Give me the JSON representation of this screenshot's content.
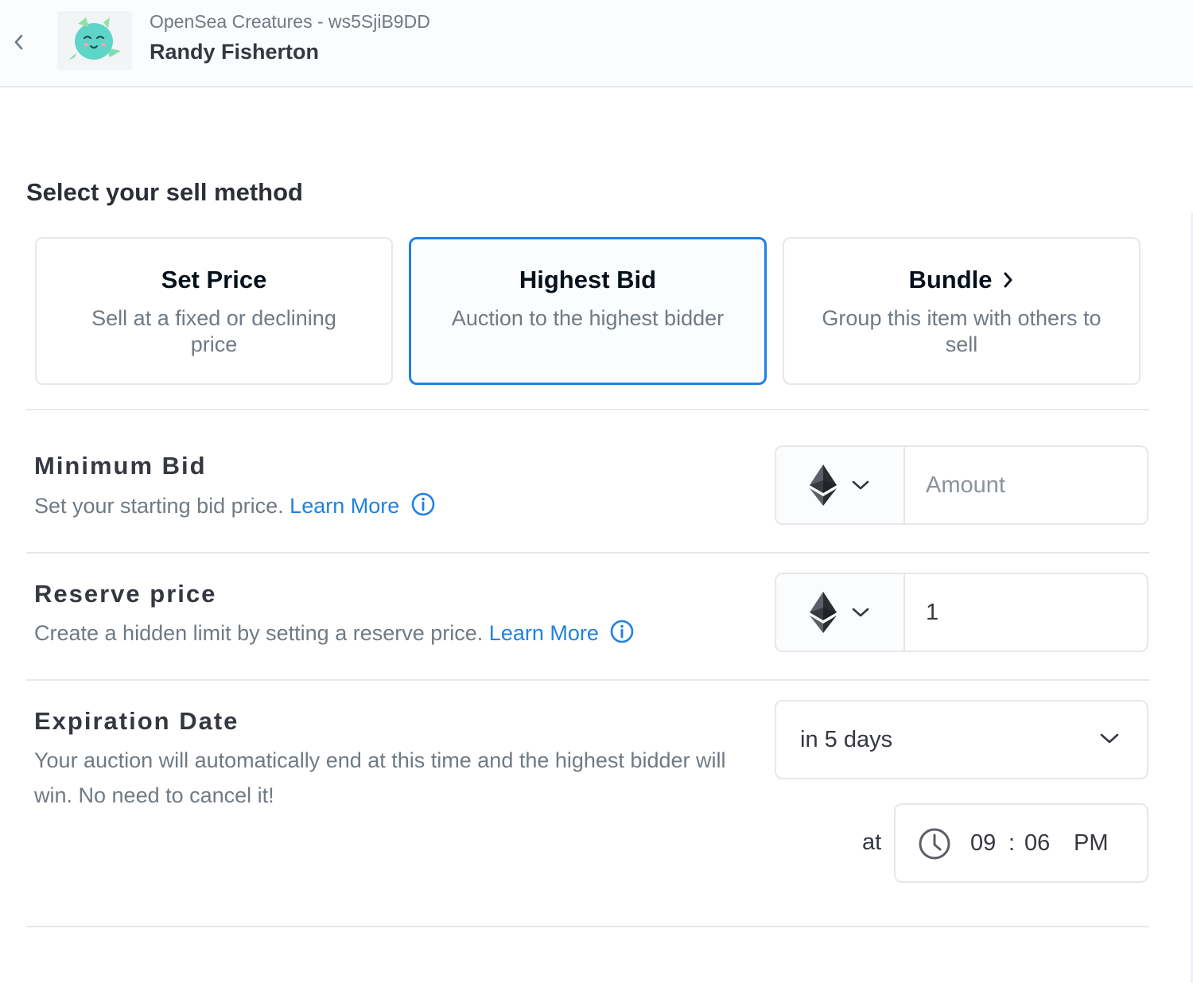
{
  "header": {
    "collection": "OpenSea Creatures - ws5SjiB9DD",
    "item_name": "Randy Fisherton",
    "back_icon": "chevron-left-icon",
    "thumbnail": "creature-thumbnail"
  },
  "sell_method": {
    "title": "Select your sell method",
    "options": [
      {
        "title": "Set Price",
        "description": "Sell at a fixed or declining price",
        "selected": false
      },
      {
        "title": "Highest Bid",
        "description": "Auction to the highest bidder",
        "selected": true
      },
      {
        "title": "Bundle",
        "description": "Group this item with others to sell",
        "selected": false,
        "icon": "chevron-right-icon"
      }
    ]
  },
  "minimum_bid": {
    "title": "Minimum Bid",
    "description": "Set your starting bid price.",
    "learn_more": "Learn More",
    "currency_icon": "ethereum-icon",
    "amount_placeholder": "Amount",
    "amount_value": ""
  },
  "reserve_price": {
    "title": "Reserve price",
    "description": "Create a hidden limit by setting a reserve price.",
    "learn_more": "Learn More",
    "currency_icon": "ethereum-icon",
    "amount_value": "1"
  },
  "expiration": {
    "title": "Expiration Date",
    "description": "Your auction will automatically end at this time and the highest bidder will win. No need to cancel it!",
    "selected_option": "in 5 days",
    "at_label": "at",
    "hour": "09",
    "colon": ":",
    "minute": "06",
    "ampm": "PM"
  },
  "colors": {
    "accent": "#2081e2",
    "text": "#353840",
    "muted": "#707a83",
    "border": "#e5e8eb",
    "creature": "#5ed5c8"
  }
}
